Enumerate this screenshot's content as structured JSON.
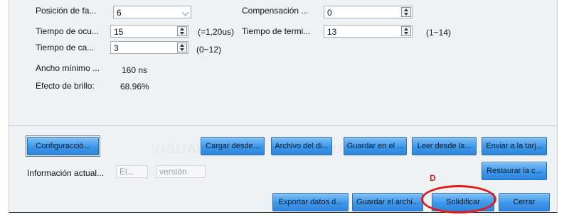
{
  "settings": {
    "pos_label": "Posición de fa...",
    "pos_value": "6",
    "comp_label": "Compensación ...",
    "comp_value": "0",
    "ocu_label": "Tiempo de ocu...",
    "ocu_value": "15",
    "ocu_hint": "(=1,20us)",
    "term_label": "Tiempo de termi...",
    "term_value": "13",
    "term_hint": "(1~14)",
    "ca_label": "Tiempo de ca...",
    "ca_value": "3",
    "ca_hint": "(0~12)",
    "ancho_label": "Ancho mínimo ...",
    "ancho_value": "160 ns",
    "brillo_label": "Efecto de brillo:",
    "brillo_value": "68.96%"
  },
  "buttons": {
    "config": "Configuracció...",
    "cargar": "Cargar desde...",
    "archivo": "Archivo del di...",
    "guardar_en": "Guardar en el ...",
    "leer": "Leer desde la...",
    "enviar": "Enviar a la tarj...",
    "restaurar": "Restaurar la c...",
    "exportar": "Exportar datos d...",
    "guardar_archi": "Guardar el archi...",
    "solidificar": "Solidificar",
    "cerrar": "Cerrar"
  },
  "info": {
    "label": "Información actual...",
    "field1": "El...",
    "field2": "versión"
  },
  "annotation": {
    "marker": "D",
    "color": "#e01919"
  },
  "watermark": {
    "text": "VISUALLED"
  }
}
